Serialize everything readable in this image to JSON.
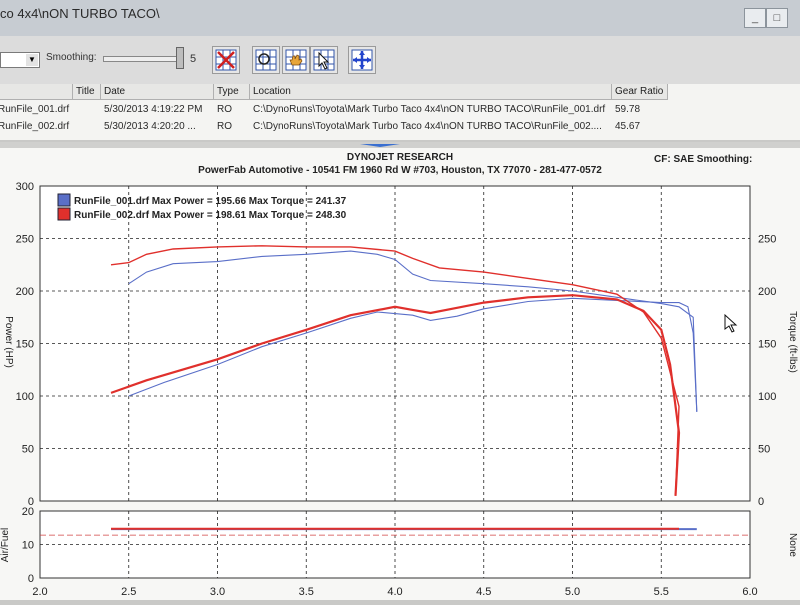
{
  "window": {
    "title": "co 4x4\\nON TURBO TACO\\"
  },
  "toolbar": {
    "smoothing_label": "Smoothing:",
    "smoothing_value": "5"
  },
  "table": {
    "headers": [
      "Title",
      "Date",
      "Type",
      "Location",
      "Gear Ratio"
    ],
    "rows": [
      {
        "file": "RunFile_001.drf",
        "date": "5/30/2013 4:19:22 PM",
        "type": "RO",
        "location": "C:\\DynoRuns\\Toyota\\Mark Turbo Taco 4x4\\nON TURBO TACO\\RunFile_001.drf",
        "gear": "59.78"
      },
      {
        "file": "RunFile_002.drf",
        "date": "5/30/2013 4:20:20 ...",
        "type": "RO",
        "location": "C:\\DynoRuns\\Toyota\\Mark Turbo Taco 4x4\\nON TURBO TACO\\RunFile_002....",
        "gear": "45.67"
      }
    ]
  },
  "report": {
    "header1": "DYNOJET RESEARCH",
    "header2": "PowerFab Automotive - 10541 FM 1960 Rd W #703, Houston, TX 77070 - 281-477-0572",
    "cf": "CF: SAE  Smoothing:"
  },
  "colors": {
    "run1": "#5a6fc8",
    "run2": "#e0302c"
  },
  "chart_data": [
    {
      "type": "line",
      "ylabel": "Power (HP)",
      "y2label": "Torque (ft-lbs)",
      "xlim": [
        2.0,
        6.0
      ],
      "ylim": [
        0,
        300
      ],
      "y2lim": [
        0,
        300
      ],
      "x_ticks": [
        "2.0",
        "2.5",
        "3.0",
        "3.5",
        "4.0",
        "4.5",
        "5.0",
        "5.5",
        "6.0"
      ],
      "y_ticks": [
        "0",
        "50",
        "100",
        "150",
        "200",
        "250",
        "300"
      ],
      "y2_ticks": [
        "0",
        "50",
        "100",
        "150",
        "200",
        "250"
      ],
      "legend": [
        {
          "text": "RunFile_001.drf Max Power = 195.66 Max Torque = 241.37",
          "color": "#5a6fc8"
        },
        {
          "text": "RunFile_002.drf Max Power = 198.61 Max Torque = 248.30",
          "color": "#e0302c"
        }
      ],
      "series": [
        {
          "name": "RunFile_001.drf",
          "measure": "power",
          "points": [
            [
              2.5,
              100
            ],
            [
              2.7,
              113
            ],
            [
              3.0,
              130
            ],
            [
              3.25,
              147
            ],
            [
              3.5,
              160
            ],
            [
              3.75,
              174
            ],
            [
              3.9,
              180
            ],
            [
              4.1,
              177
            ],
            [
              4.2,
              172
            ],
            [
              4.35,
              176
            ],
            [
              4.5,
              183
            ],
            [
              4.75,
              190
            ],
            [
              5.0,
              193
            ],
            [
              5.25,
              191
            ],
            [
              5.5,
              189
            ],
            [
              5.6,
              189
            ],
            [
              5.65,
              185
            ],
            [
              5.68,
              160
            ],
            [
              5.7,
              85
            ]
          ]
        },
        {
          "name": "RunFile_001.drf",
          "measure": "torque",
          "points": [
            [
              2.5,
              207
            ],
            [
              2.6,
              218
            ],
            [
              2.75,
              226
            ],
            [
              3.0,
              228
            ],
            [
              3.25,
              233
            ],
            [
              3.5,
              235
            ],
            [
              3.75,
              238
            ],
            [
              3.9,
              235
            ],
            [
              4.0,
              230
            ],
            [
              4.1,
              216
            ],
            [
              4.2,
              210
            ],
            [
              4.5,
              207
            ],
            [
              4.75,
              204
            ],
            [
              5.0,
              200
            ],
            [
              5.25,
              194
            ],
            [
              5.5,
              188
            ],
            [
              5.6,
              185
            ],
            [
              5.68,
              175
            ],
            [
              5.7,
              85
            ]
          ]
        },
        {
          "name": "RunFile_002.drf",
          "measure": "power",
          "points": [
            [
              2.4,
              103
            ],
            [
              2.6,
              115
            ],
            [
              3.0,
              135
            ],
            [
              3.25,
              150
            ],
            [
              3.5,
              163
            ],
            [
              3.75,
              177
            ],
            [
              4.0,
              185
            ],
            [
              4.1,
              182
            ],
            [
              4.2,
              179
            ],
            [
              4.35,
              184
            ],
            [
              4.5,
              189
            ],
            [
              4.75,
              194
            ],
            [
              5.0,
              196
            ],
            [
              5.25,
              192
            ],
            [
              5.4,
              181
            ],
            [
              5.5,
              163
            ],
            [
              5.55,
              130
            ],
            [
              5.6,
              65
            ],
            [
              5.58,
              5
            ]
          ]
        },
        {
          "name": "RunFile_002.drf",
          "measure": "torque",
          "points": [
            [
              2.4,
              225
            ],
            [
              2.5,
              227
            ],
            [
              2.6,
              235
            ],
            [
              2.75,
              240
            ],
            [
              3.0,
              242
            ],
            [
              3.25,
              243
            ],
            [
              3.5,
              242
            ],
            [
              3.75,
              242
            ],
            [
              4.0,
              238
            ],
            [
              4.1,
              231
            ],
            [
              4.25,
              222
            ],
            [
              4.5,
              218
            ],
            [
              4.75,
              212
            ],
            [
              5.0,
              206
            ],
            [
              5.25,
              197
            ],
            [
              5.4,
              180
            ],
            [
              5.5,
              155
            ],
            [
              5.6,
              90
            ],
            [
              5.58,
              5
            ]
          ]
        }
      ]
    },
    {
      "type": "line",
      "ylabel": "Air/Fuel",
      "y2label": "None",
      "xlim": [
        2.0,
        6.0
      ],
      "ylim": [
        0,
        20
      ],
      "y_ticks": [
        "0",
        "10",
        "20"
      ],
      "series": [
        {
          "name": "RunFile_001.drf",
          "values_x": [
            2.4,
            5.7
          ],
          "values_y": [
            14.6,
            14.6
          ]
        },
        {
          "name": "RunFile_002.drf",
          "values_x": [
            2.4,
            5.6
          ],
          "values_y": [
            14.7,
            14.7
          ]
        }
      ]
    }
  ]
}
